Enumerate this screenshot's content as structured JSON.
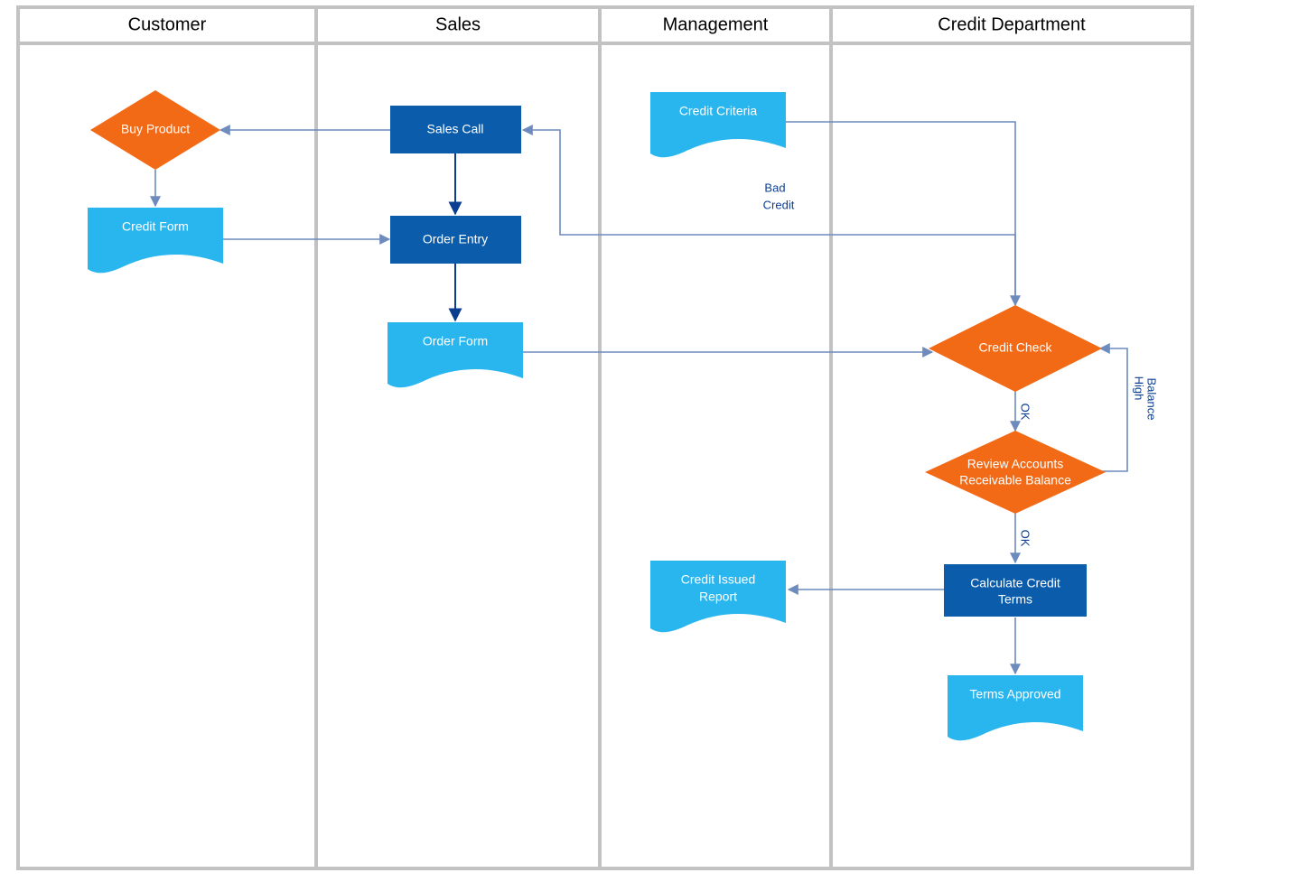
{
  "lanes": {
    "customer": "Customer",
    "sales": "Sales",
    "management": "Management",
    "credit_dept": "Credit Department"
  },
  "nodes": {
    "buy_product": "Buy Product",
    "credit_form": "Credit Form",
    "sales_call": "Sales Call",
    "order_entry": "Order Entry",
    "order_form": "Order Form",
    "credit_criteria": "Credit Criteria",
    "credit_issued_report_l1": "Credit Issued",
    "credit_issued_report_l2": "Report",
    "credit_check": "Credit Check",
    "review_ar_l1": "Review Accounts",
    "review_ar_l2": "Receivable Balance",
    "calc_credit_terms_l1": "Calculate Credit",
    "calc_credit_terms_l2": "Terms",
    "terms_approved": "Terms Approved"
  },
  "edges": {
    "bad_credit_l1": "Bad",
    "bad_credit_l2": "Credit",
    "ok1": "OK",
    "ok2": "OK",
    "high_balance_l1": "High",
    "high_balance_l2": "Balance"
  },
  "colors": {
    "lane_border": "#c2c2c2",
    "process": "#0b5cab",
    "decision": "#f26a16",
    "document": "#29b6ef",
    "arrow": "#6d8bbd",
    "arrow_dark": "#0b3e91"
  }
}
